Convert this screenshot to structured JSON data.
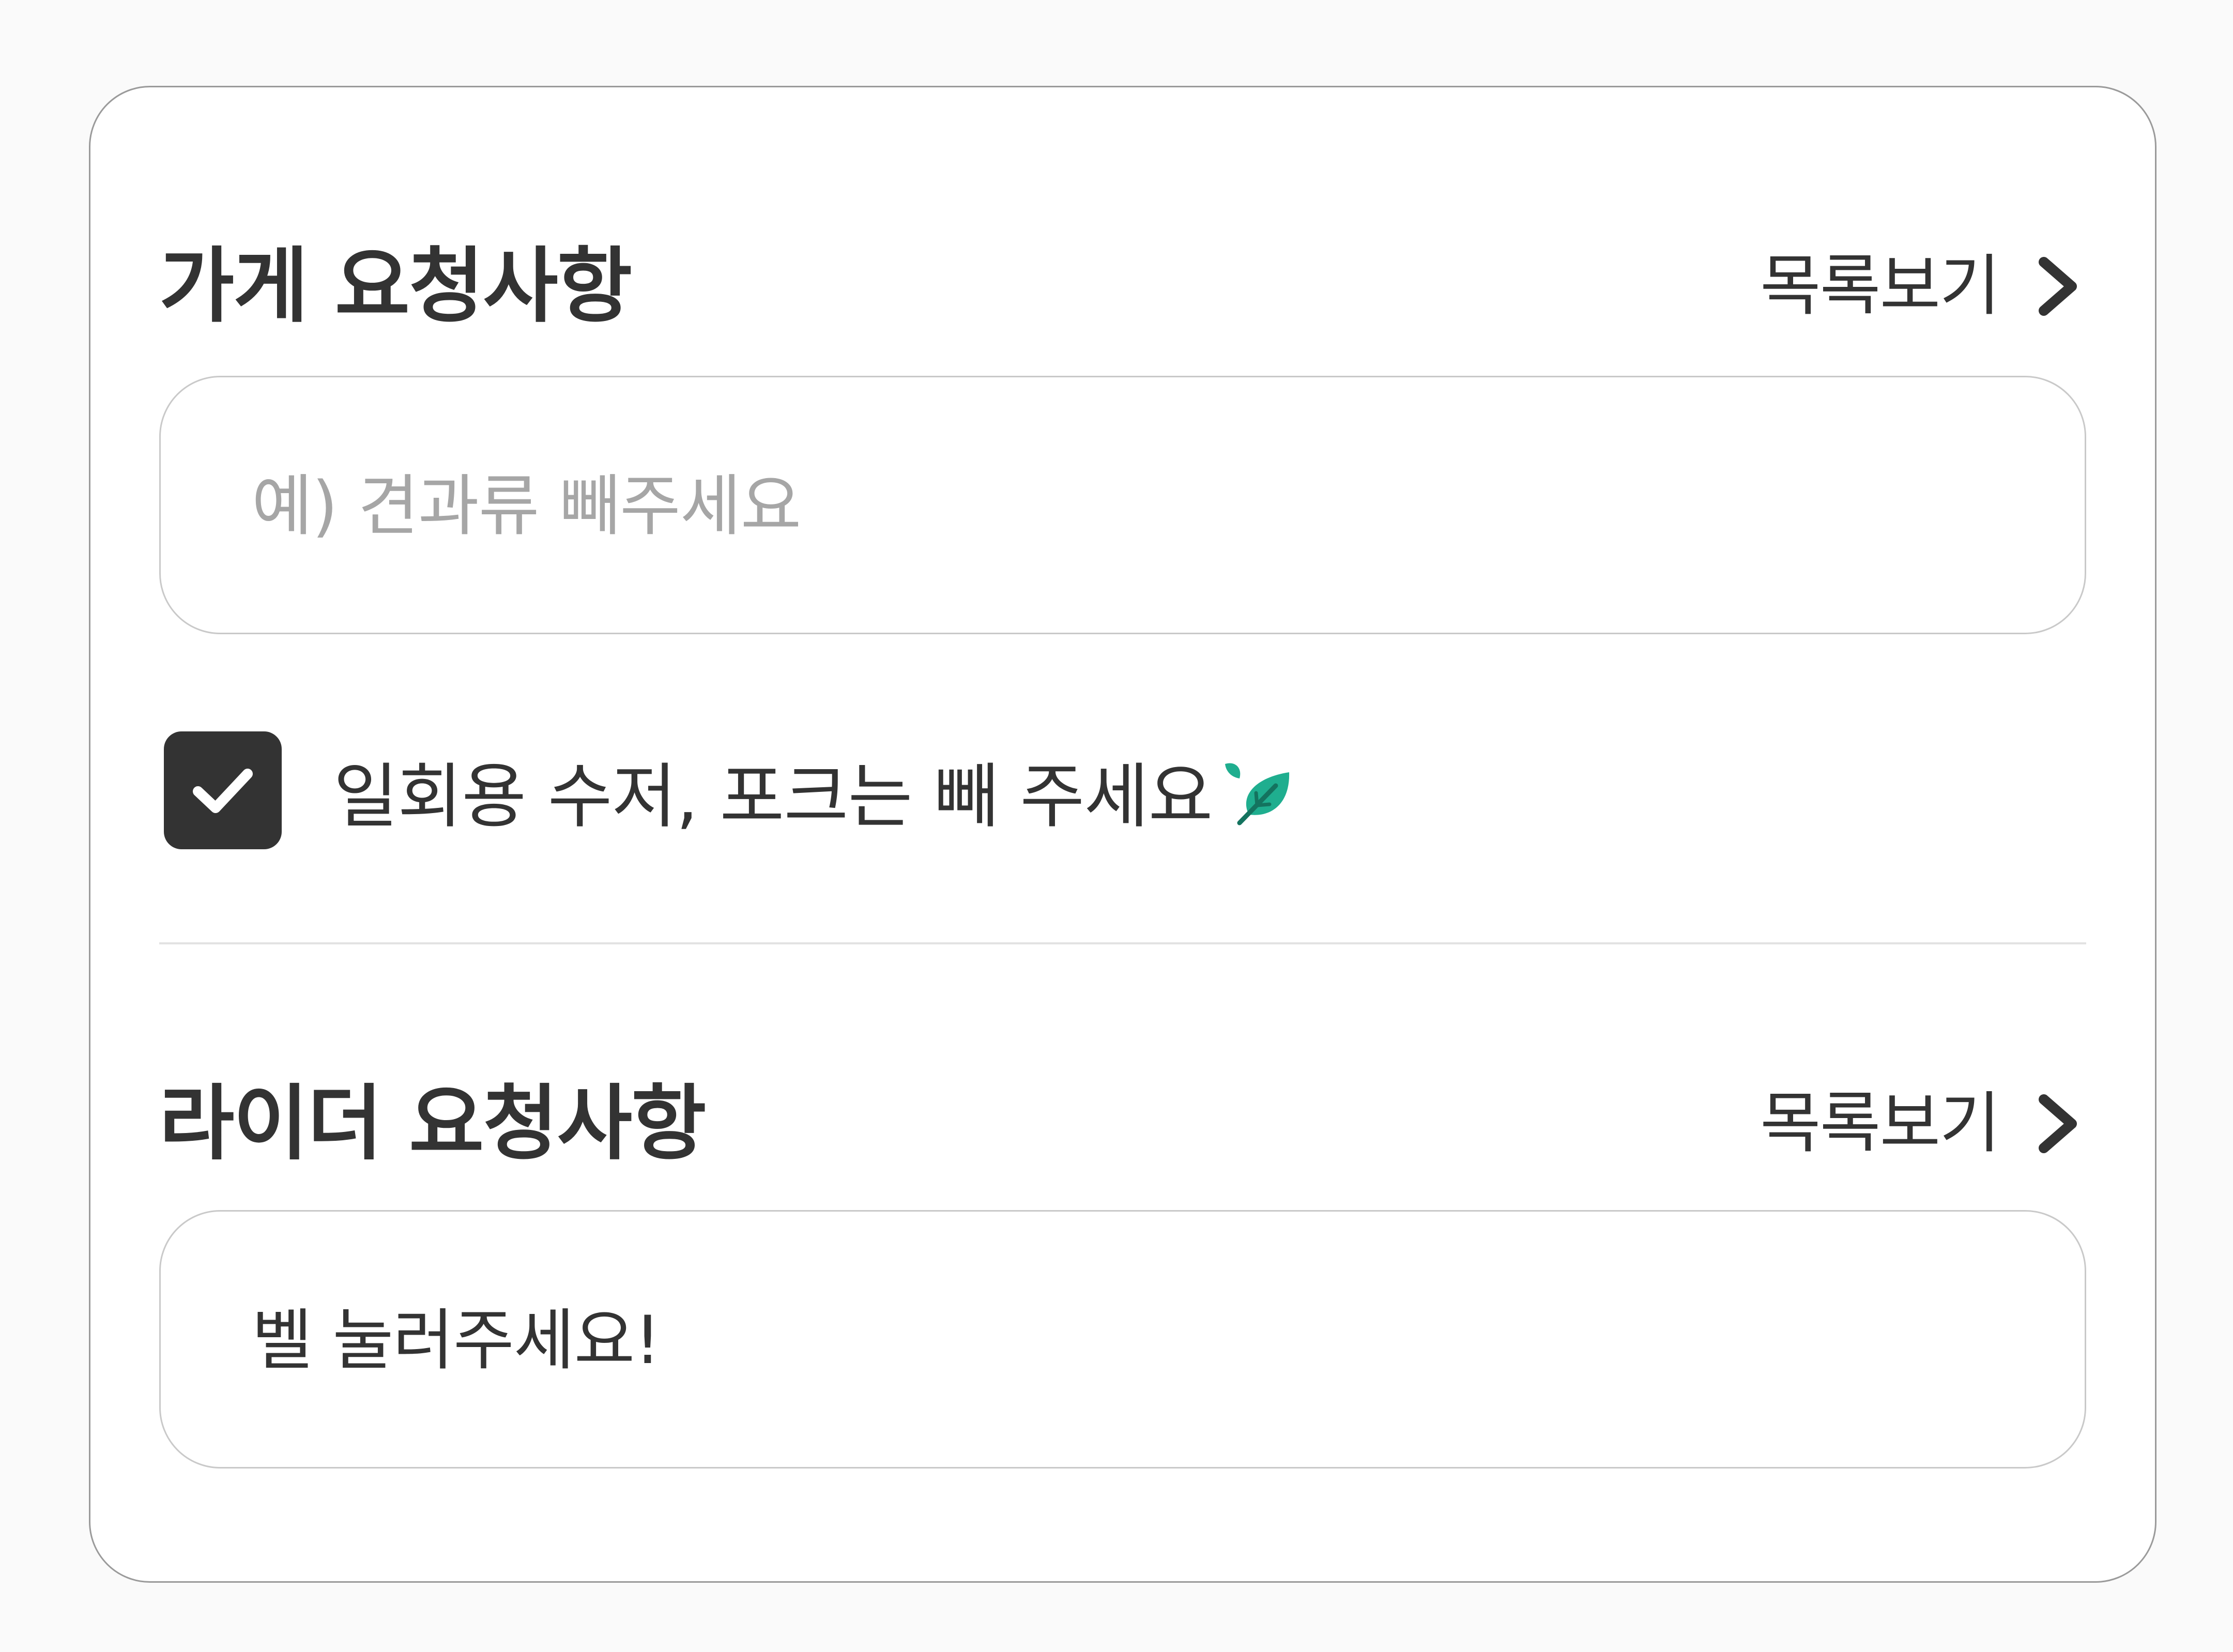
{
  "store_request": {
    "title": "가게 요청사항",
    "list_link_label": "목록보기",
    "list_link_icon": "chevron-right-icon",
    "input": {
      "value": "",
      "placeholder": "예) 견과류 빼주세요"
    },
    "checkbox": {
      "checked": true,
      "label": "일회용 수저, 포크는 빼 주세요",
      "label_icon": "leaf-icon"
    }
  },
  "rider_request": {
    "title": "라이더 요청사항",
    "list_link_label": "목록보기",
    "list_link_icon": "chevron-right-icon",
    "input": {
      "value": "벨 눌러주세요!"
    }
  },
  "colors": {
    "text": "#333333",
    "placeholder": "#a6a6a6",
    "checkbox_fill": "#333333",
    "leaf_accent": "#1fae8f",
    "border": "#c9c9c9"
  }
}
